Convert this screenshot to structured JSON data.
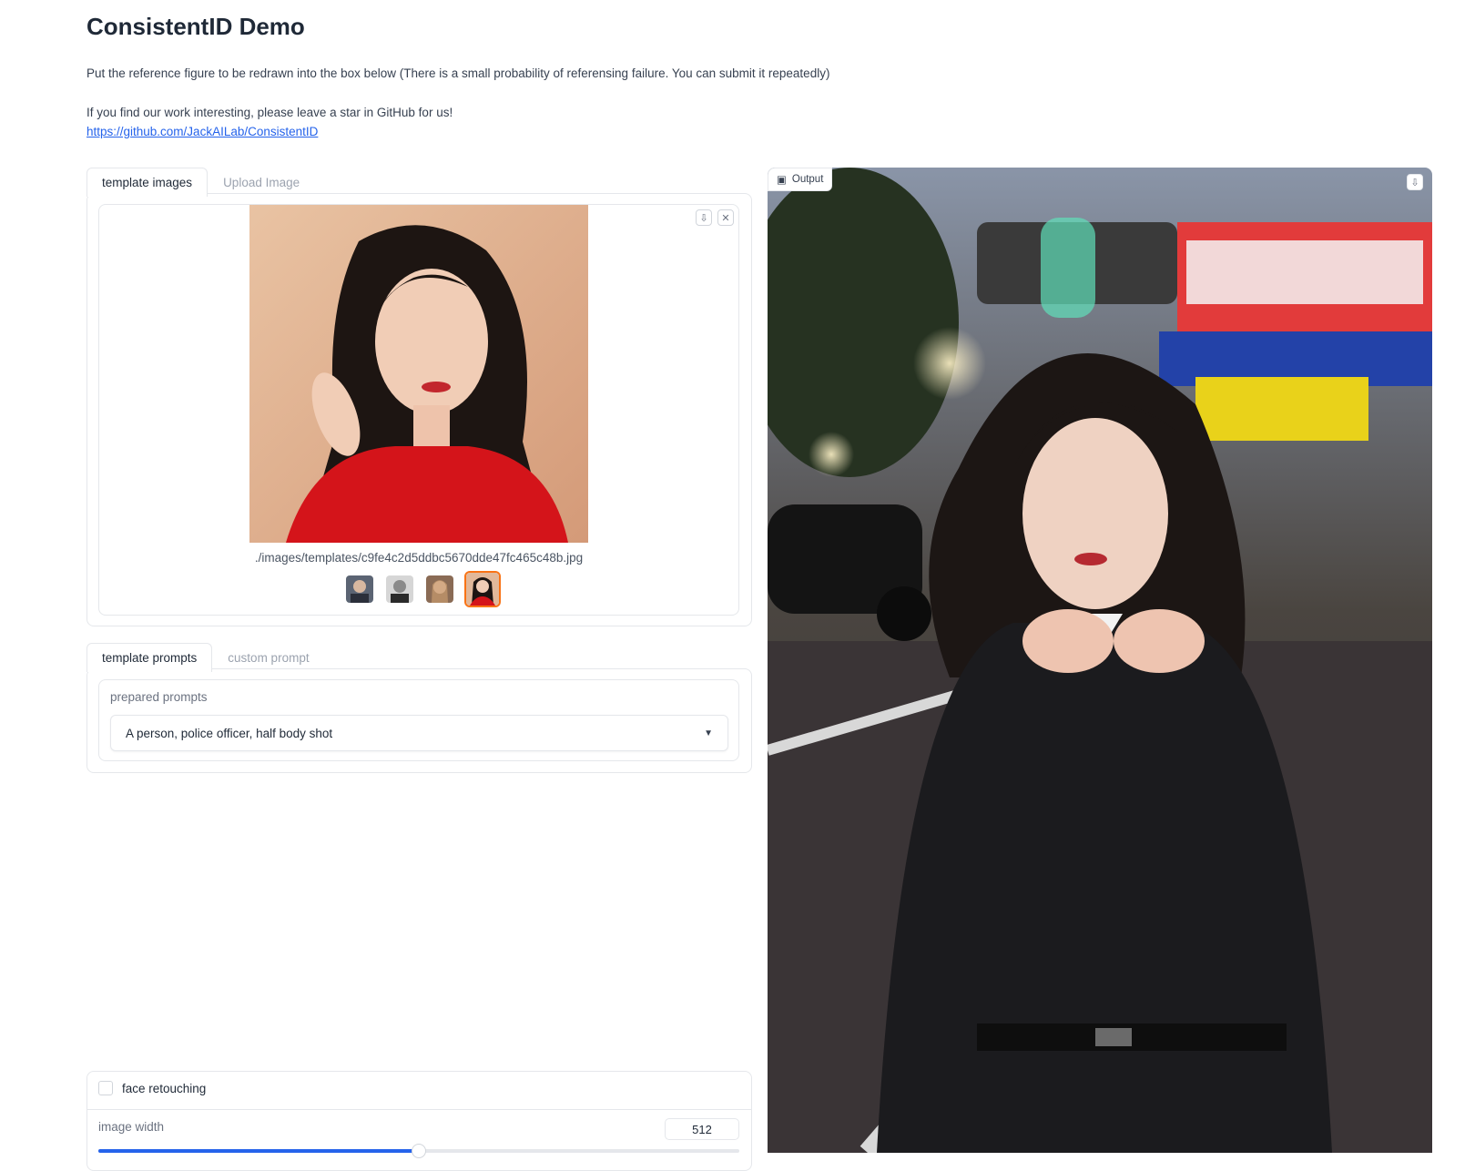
{
  "page": {
    "title": "ConsistentID Demo",
    "intro_line1": "Put the reference figure to be redrawn into the box below (There is a small probability of referensing failure. You can submit it repeatedly)",
    "intro_line2": "If you find our work interesting, please leave a star in GitHub for us!",
    "github_link": "https://github.com/JackAILab/ConsistentID"
  },
  "image_tabs": [
    "template images",
    "Upload Image"
  ],
  "template_gallery": {
    "selected_file": "./images/templates/c9fe4c2d5ddbc5670dde47fc465c48b.jpg",
    "download_icon": "download-icon",
    "close_icon": "close-icon",
    "thumbnail_count": 4,
    "selected_index": 3
  },
  "prompt_tabs": [
    "template prompts",
    "custom prompt"
  ],
  "prompts": {
    "label": "prepared prompts",
    "selected": "A person, police officer, half body shot"
  },
  "settings": {
    "face_retouching_label": "face retouching",
    "face_retouching_checked": false,
    "image_width_label": "image width",
    "image_width_value": "512",
    "image_width_fraction": 0.5
  },
  "output": {
    "label": "Output",
    "image_icon": "image-icon",
    "download_icon": "download-icon"
  },
  "colors": {
    "accent": "#f97316",
    "link": "#2563eb",
    "slider": "#2563eb"
  }
}
